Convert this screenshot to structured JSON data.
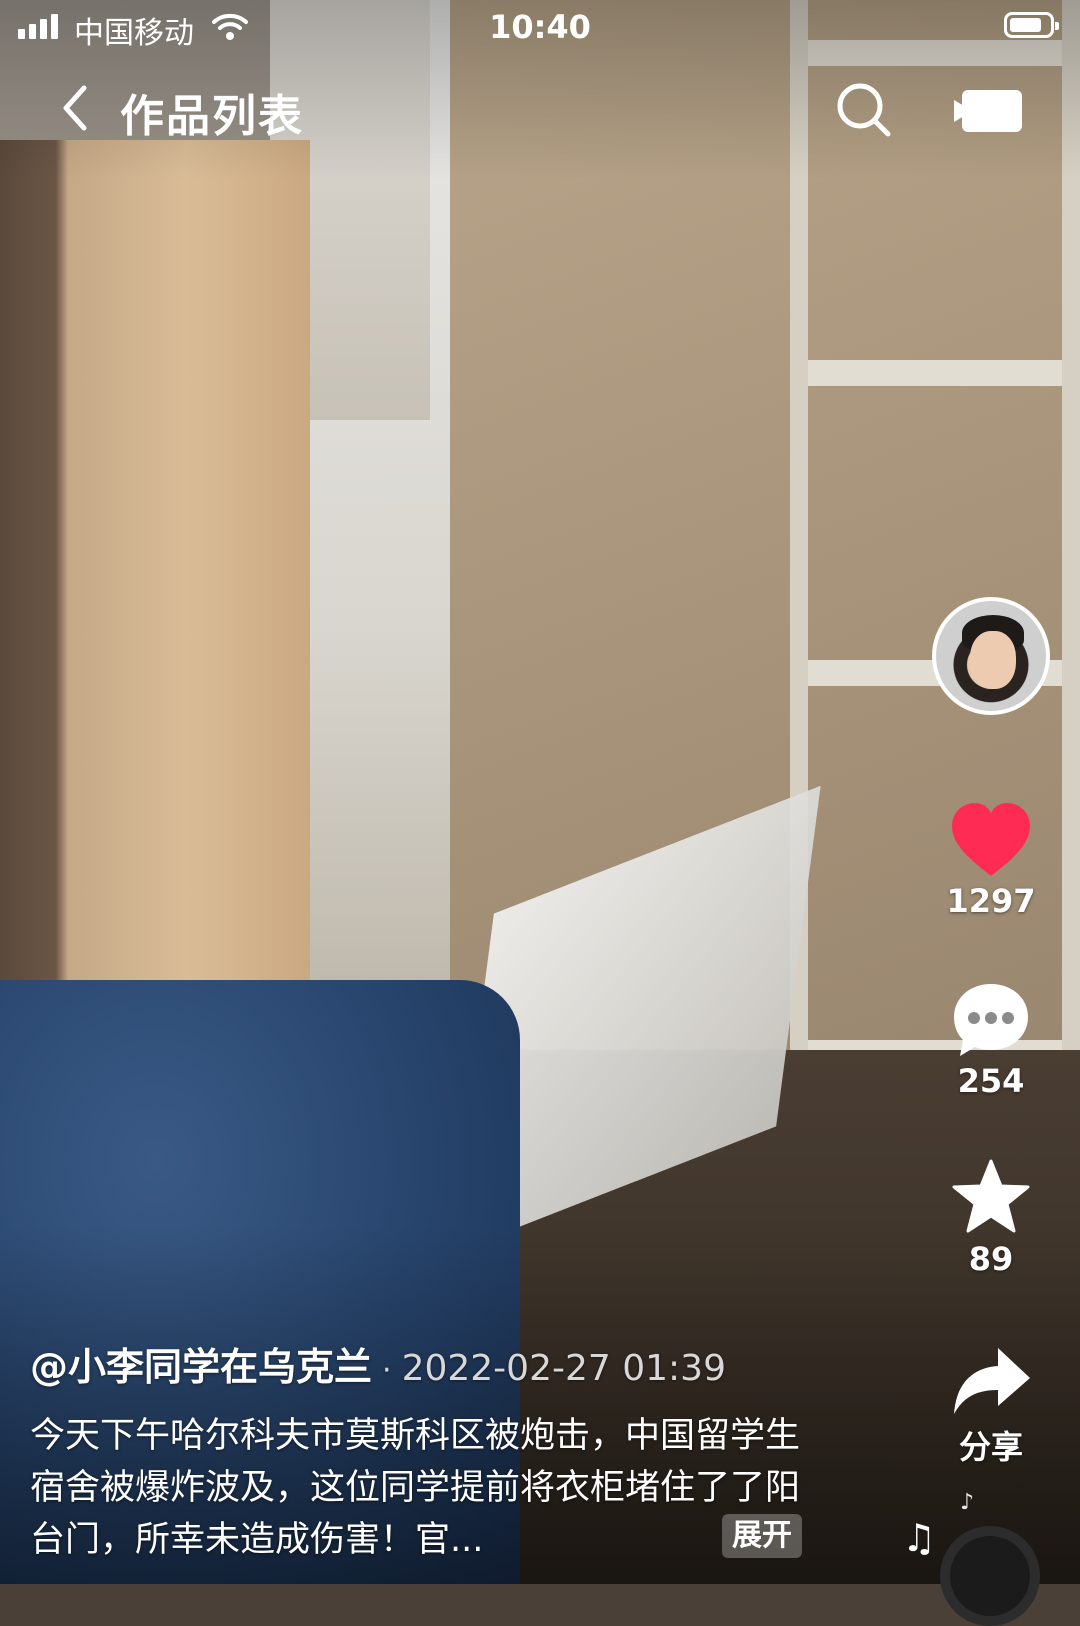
{
  "status_bar": {
    "carrier": "中国移动",
    "time": "10:40",
    "icons": [
      "signal-icon",
      "wifi-icon",
      "battery-icon"
    ]
  },
  "header": {
    "title": "作品列表",
    "icons": [
      "back-icon",
      "search-icon",
      "camera-icon"
    ]
  },
  "actions": {
    "likes": "1297",
    "comments": "254",
    "favorites": "89",
    "share_label": "分享",
    "colors": {
      "like": "#fe2c55",
      "icon": "#ffffff"
    }
  },
  "post": {
    "author": "@小李同学在乌克兰",
    "separator": "·",
    "date": "2022-02-27 01:39",
    "description": "今天下午哈尔科夫市莫斯科区被炮击，中国留学生宿舍被爆炸波及，这位同学提前将衣柜堵住了了阳台门，所幸未造成伤害！官...",
    "expand_label": "展开"
  },
  "music": {
    "note_symbol": "♫",
    "small_note": "♪"
  }
}
